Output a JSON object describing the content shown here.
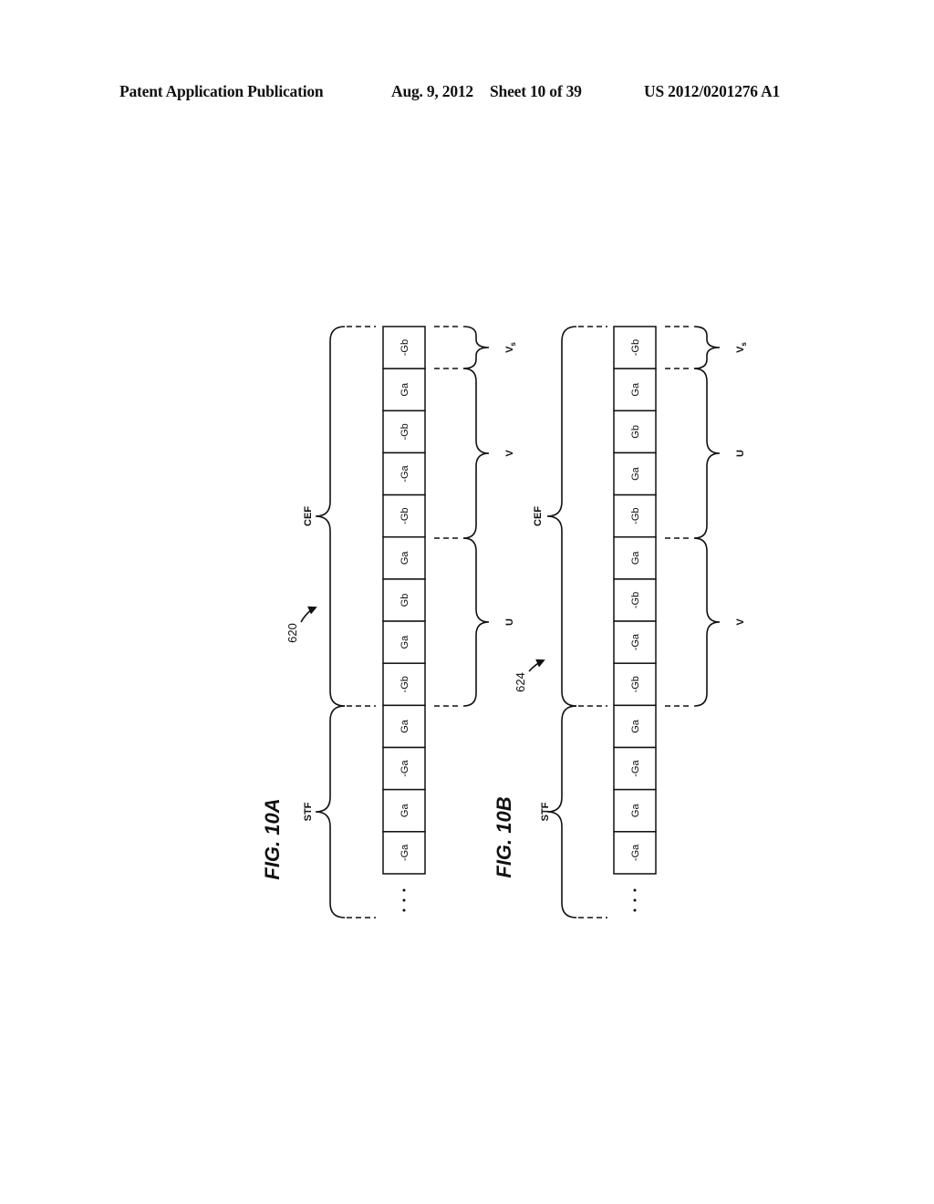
{
  "header": {
    "publication": "Patent Application Publication",
    "date": "Aug. 9, 2012",
    "sheet": "Sheet 10 of 39",
    "number": "US 2012/0201276 A1"
  },
  "figures": [
    {
      "id": "10A",
      "caption": "FIG. 10A",
      "ref_numeral": "620",
      "cells": [
        "-Gb",
        "Ga",
        "-Gb",
        "-Ga",
        "-Gb",
        "Ga",
        "Gb",
        "Ga",
        "-Gb",
        "Ga",
        "-Ga",
        "Ga",
        "-Ga"
      ],
      "continuation": "...",
      "group_labels": {
        "top": "CEF",
        "bottom": "STF"
      },
      "sub_groups": [
        {
          "label": "Vs",
          "label_main": "V",
          "label_sub": "s"
        },
        {
          "label": "V",
          "label_main": "V",
          "label_sub": ""
        },
        {
          "label": "U",
          "label_main": "U",
          "label_sub": ""
        }
      ]
    },
    {
      "id": "10B",
      "caption": "FIG. 10B",
      "ref_numeral": "624",
      "cells": [
        "-Gb",
        "Ga",
        "Gb",
        "Ga",
        "-Gb",
        "Ga",
        "-Gb",
        "-Ga",
        "-Gb",
        "Ga",
        "-Ga",
        "Ga",
        "-Ga"
      ],
      "continuation": "...",
      "group_labels": {
        "top": "CEF",
        "bottom": "STF"
      },
      "sub_groups": [
        {
          "label": "Vs",
          "label_main": "V",
          "label_sub": "s"
        },
        {
          "label": "U",
          "label_main": "U",
          "label_sub": ""
        },
        {
          "label": "V",
          "label_main": "V",
          "label_sub": ""
        }
      ]
    }
  ]
}
